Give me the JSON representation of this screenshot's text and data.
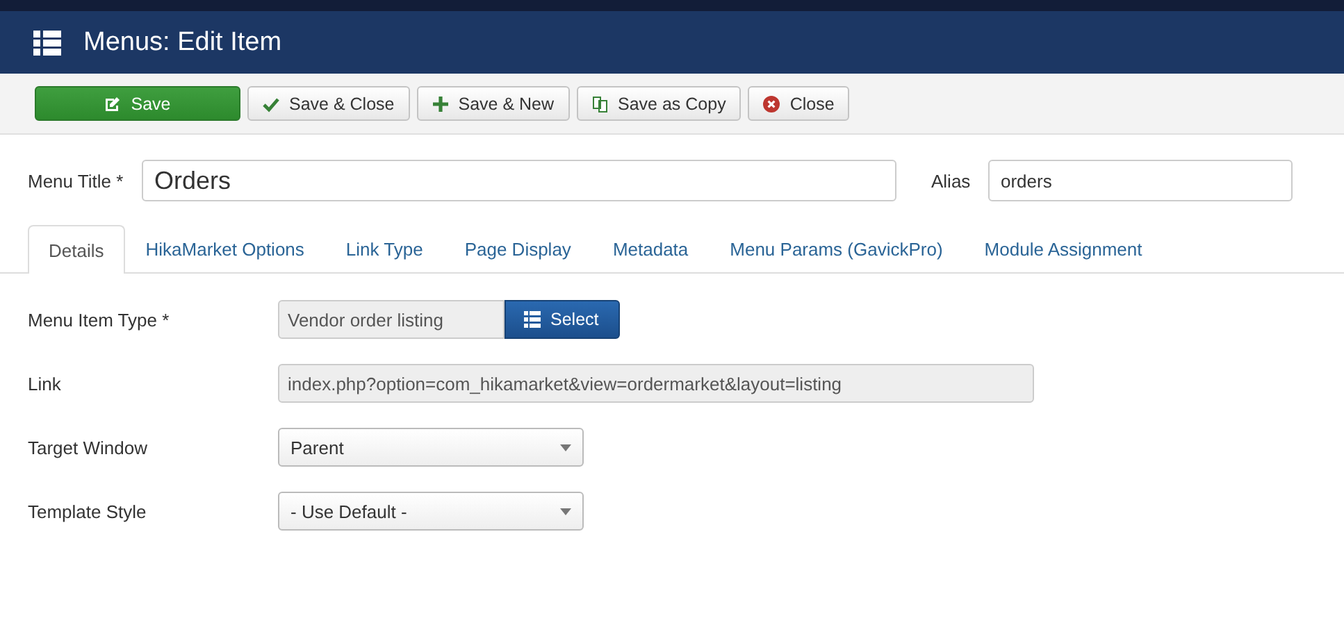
{
  "header": {
    "title": "Menus: Edit Item"
  },
  "toolbar": [
    {
      "label": "Save",
      "kind": "save",
      "primary": true
    },
    {
      "label": "Save & Close",
      "kind": "check",
      "primary": false
    },
    {
      "label": "Save & New",
      "kind": "plus",
      "primary": false
    },
    {
      "label": "Save as Copy",
      "kind": "copy",
      "primary": false
    },
    {
      "label": "Close",
      "kind": "close",
      "primary": false
    }
  ],
  "title_field": {
    "label": "Menu Title *",
    "value": "Orders"
  },
  "alias_field": {
    "label": "Alias",
    "value": "orders"
  },
  "tabs": [
    {
      "label": "Details",
      "selected": true
    },
    {
      "label": "HikaMarket Options",
      "selected": false
    },
    {
      "label": "Link Type",
      "selected": false
    },
    {
      "label": "Page Display",
      "selected": false
    },
    {
      "label": "Metadata",
      "selected": false
    },
    {
      "label": "Menu Params (GavickPro)",
      "selected": false
    },
    {
      "label": "Module Assignment",
      "selected": false
    }
  ],
  "fields": [
    {
      "kind": "type",
      "label": "Menu Item Type *",
      "value": "Vendor order listing",
      "button": "Select"
    },
    {
      "kind": "readonly",
      "label": "Link",
      "value": "index.php?option=com_hikamarket&view=ordermarket&layout=listing"
    },
    {
      "kind": "dropdown",
      "label": "Target Window",
      "value": "Parent"
    },
    {
      "kind": "dropdown",
      "label": "Template Style",
      "value": "- Use Default -"
    }
  ]
}
